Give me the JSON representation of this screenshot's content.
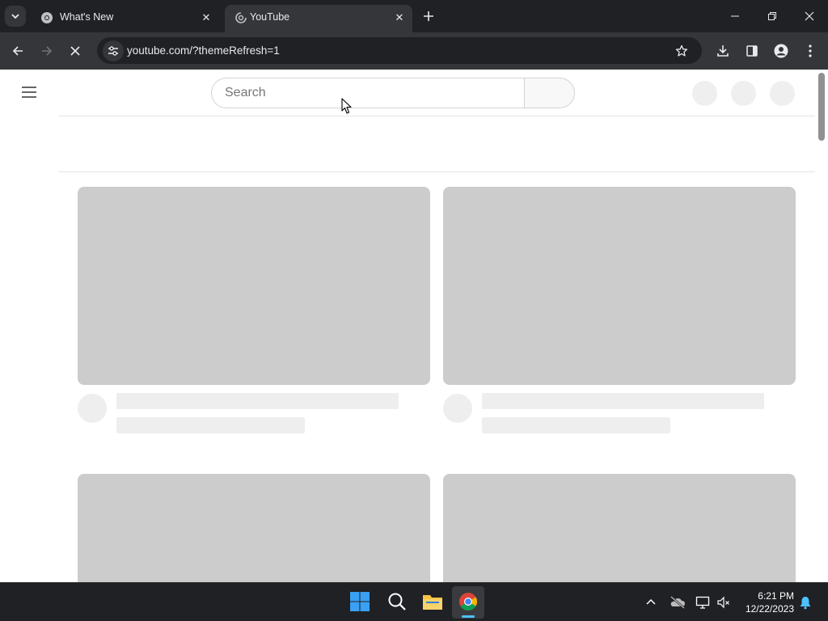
{
  "browser": {
    "tabs": [
      {
        "title": "What's New",
        "active": false
      },
      {
        "title": "YouTube",
        "active": true
      }
    ],
    "address_bar": {
      "url": "youtube.com/?themeRefresh=1"
    }
  },
  "page": {
    "search": {
      "placeholder": "Search"
    }
  },
  "taskbar": {
    "clock": {
      "time": "6:21 PM",
      "date": "12/22/2023"
    }
  },
  "colors": {
    "chrome_dark": "#202124",
    "toolbar": "#35363a",
    "skeleton": "#cccccc",
    "skeleton_light": "#eeeeee"
  }
}
